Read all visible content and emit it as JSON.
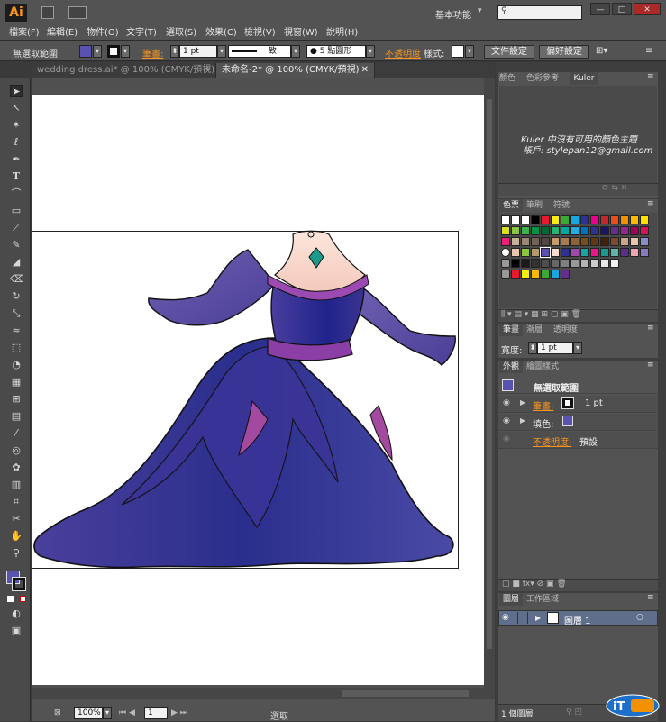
{
  "app": {
    "logo": "Ai"
  },
  "menu": {
    "items": [
      "檔案(F)",
      "編輯(E)",
      "物件(O)",
      "文字(T)",
      "選取(S)",
      "效果(C)",
      "檢視(V)",
      "視窗(W)",
      "說明(H)"
    ],
    "workspace": "基本功能"
  },
  "control": {
    "selection_label": "無選取範圍",
    "stroke_label": "筆畫:",
    "stroke_value": "1 pt",
    "line_style": "一致",
    "brush": "5 點圓形",
    "opacity_label": "不透明度",
    "style_label": "樣式:",
    "doc_setup": "文件設定",
    "prefs": "偏好設定"
  },
  "tabs": [
    "wedding dress.ai* @ 100% (CMYK/預視)",
    "未命名-2* @ 100% (CMYK/預視)"
  ],
  "color_panel": {
    "tabs": [
      "顏色",
      "色彩參考",
      "Kuler"
    ],
    "message1": "Kuler 中沒有可用的顏色主題",
    "message2": "帳戶: stylepan12@gmail.com"
  },
  "swatch_panel": {
    "tabs": [
      "色票",
      "筆刷",
      "符號"
    ]
  },
  "stroke_panel": {
    "tabs": [
      "筆畫",
      "漸層",
      "透明度"
    ],
    "weight_label": "寬度:",
    "weight_value": "1 pt"
  },
  "appearance_panel": {
    "tabs": [
      "外觀",
      "繪圖樣式"
    ],
    "title": "無選取範圍",
    "stroke_label": "筆畫:",
    "stroke_value": "1 pt",
    "fill_label": "填色:",
    "opacity_label": "不透明度:",
    "opacity_value": "預設"
  },
  "layers_panel": {
    "tabs": [
      "圖層",
      "工作區域"
    ],
    "layer_name": "圖層 1",
    "count": "1 個圖層"
  },
  "status": {
    "zoom": "100%",
    "page": "1",
    "mode": "選取"
  },
  "colors": {
    "dress_purple": "#3b3597",
    "panel_bg": "#535353",
    "accent_orange": "#f7941d"
  }
}
